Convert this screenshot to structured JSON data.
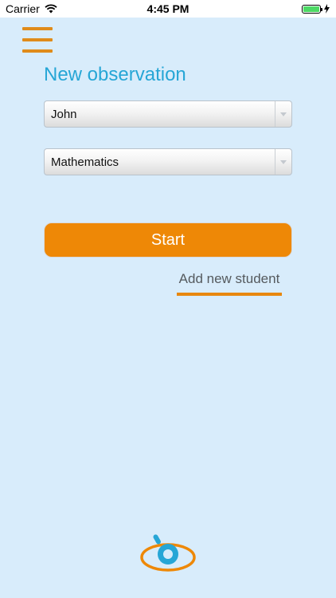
{
  "status_bar": {
    "carrier": "Carrier",
    "time": "4:45 PM",
    "wifi_icon": "wifi-icon",
    "battery_icon": "battery-icon",
    "charging_icon": "charging-bolt-icon"
  },
  "header": {
    "menu_icon": "hamburger-menu-icon",
    "title": "New observation"
  },
  "form": {
    "student_select": {
      "value": "John"
    },
    "subject_select": {
      "value": "Mathematics"
    }
  },
  "actions": {
    "start_label": "Start",
    "add_student_label": "Add new student"
  },
  "colors": {
    "background": "#d8ecfb",
    "title": "#26a6d6",
    "accent_orange": "#ee8806",
    "logo_blue": "#26a6d6"
  },
  "footer": {
    "logo_icon": "eye-logo-icon"
  }
}
